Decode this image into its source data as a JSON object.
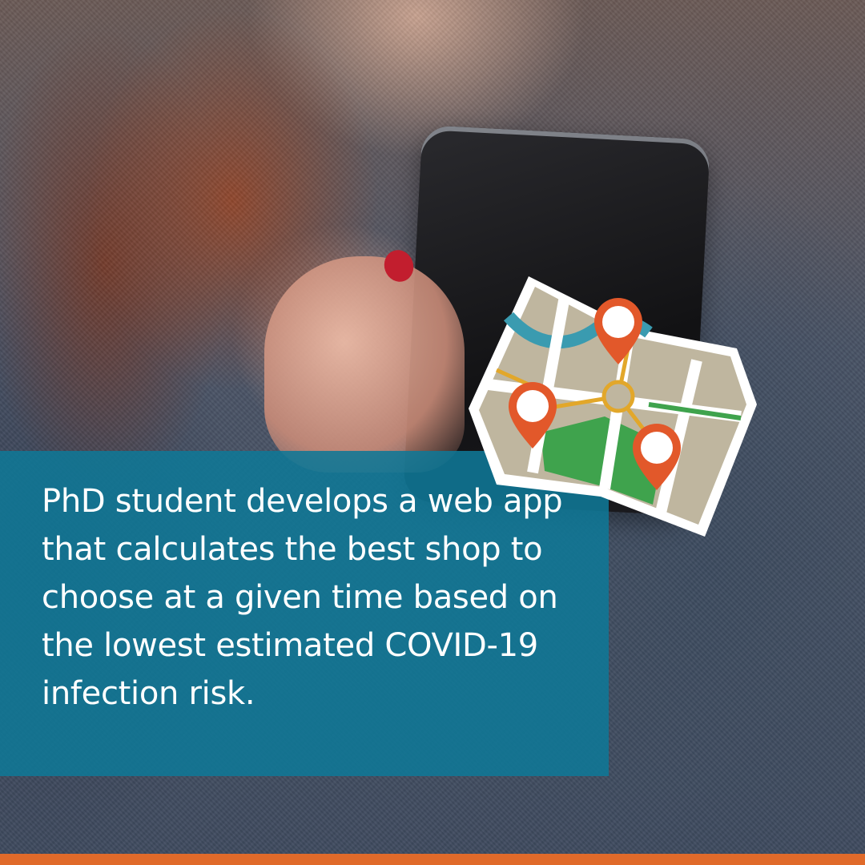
{
  "background": {
    "photo_subject": "person-holding-smartphone-icon",
    "jacket_color": "#4a5670",
    "hair_color": "#9b4a2e",
    "nail_color": "#c21e2e"
  },
  "headline": {
    "text": "PhD student develops a web app that calculates the best shop to choose at a given time based on the lowest estimated COVID-19 infection risk.",
    "color": "#ffffff"
  },
  "text_panel": {
    "color": "#0f7896"
  },
  "map_icon": {
    "name": "map-with-location-pins-icon",
    "paper_color": "#bfb69f",
    "park_color": "#3fa34d",
    "river_color": "#3a9bb0",
    "route_color": "#e2a72a",
    "pin_color": "#e2582a",
    "pin_count": 3
  },
  "accent_bar": {
    "color": "#e06a2a"
  }
}
